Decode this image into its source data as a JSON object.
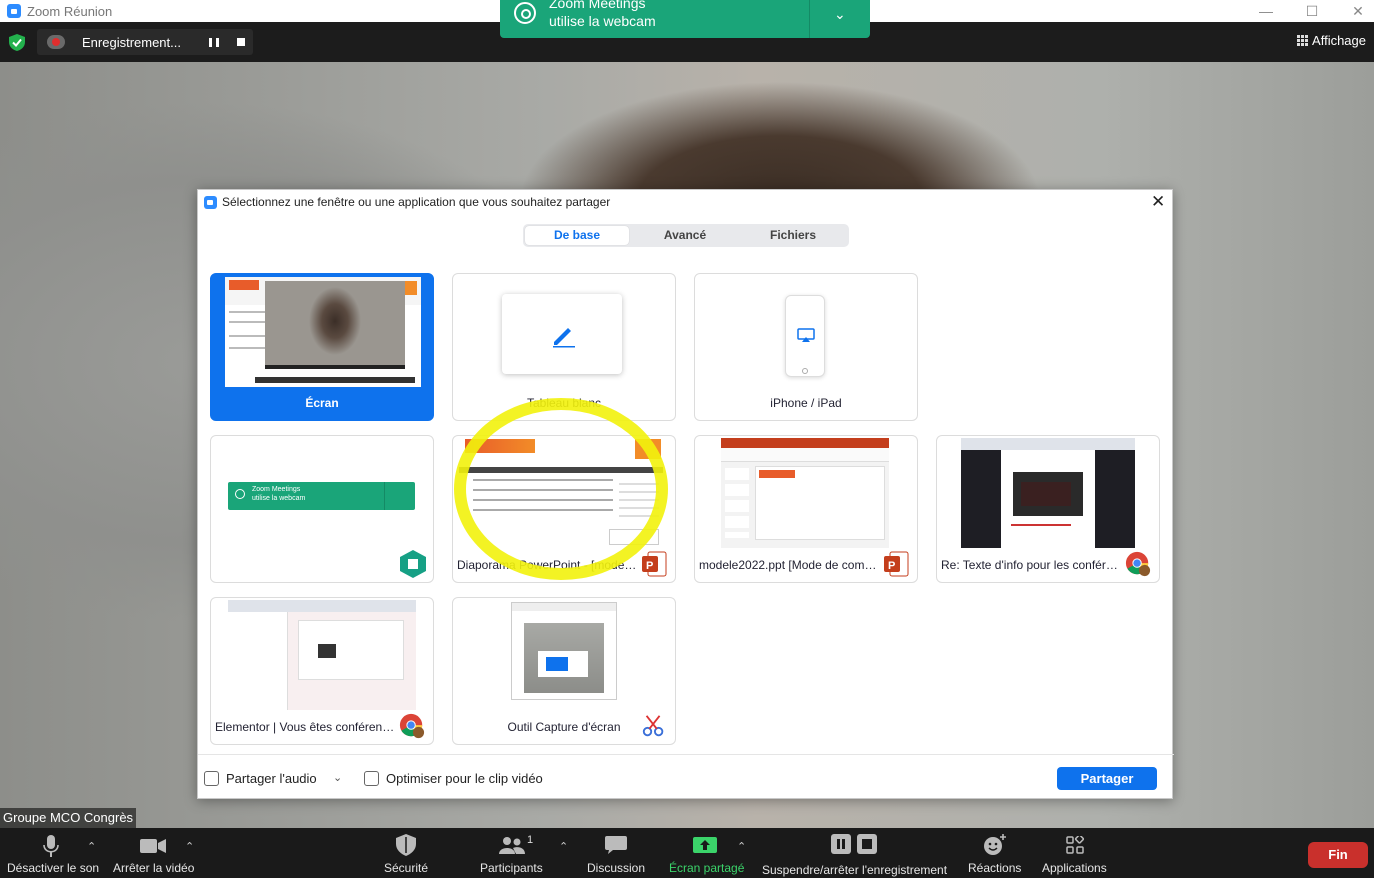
{
  "window": {
    "title": "Zoom Réunion",
    "controls": [
      "—",
      "☐",
      "✕"
    ]
  },
  "topbar": {
    "recording_label": "Enregistrement...",
    "view_label": "Affichage"
  },
  "notification": {
    "line1": "Zoom Meetings",
    "line2": "utilise la webcam"
  },
  "name_tag": "Groupe MCO Congrès",
  "dialog": {
    "title": "Sélectionnez une fenêtre ou une application que vous souhaitez partager",
    "tabs": [
      {
        "label": "De base",
        "active": true
      },
      {
        "label": "Avancé",
        "active": false
      },
      {
        "label": "Fichiers",
        "active": false
      }
    ],
    "items": [
      {
        "label": "Écran",
        "selected": true
      },
      {
        "label": "Tableau blanc"
      },
      {
        "label": "iPhone / iPad"
      },
      {
        "label": "",
        "thumb_line1": "Zoom Meetings",
        "thumb_line2": "utilise la webcam"
      },
      {
        "label": "Diaporama PowerPoint - [model..."
      },
      {
        "label": "modele2022.ppt [Mode de comp..."
      },
      {
        "label": "Re: Texte d'info pour les conféren..."
      },
      {
        "label": "Elementor | Vous êtes conférenci..."
      },
      {
        "label": "Outil Capture d'écran"
      }
    ],
    "footer": {
      "share_audio": "Partager l'audio",
      "optimize_video": "Optimiser pour le clip vidéo",
      "share_button": "Partager"
    }
  },
  "toolbar": {
    "mute": "Désactiver le son",
    "video": "Arrêter la vidéo",
    "security": "Sécurité",
    "participants": "Participants",
    "participants_count": "1",
    "chat": "Discussion",
    "share": "Écran partagé",
    "record": "Suspendre/arrêter l'enregistrement",
    "reactions": "Réactions",
    "apps": "Applications",
    "end": "Fin"
  },
  "colors": {
    "zoom_blue": "#0e72ed",
    "notif_green": "#1aa579",
    "share_green": "#3bd46a",
    "end_red": "#c9302c",
    "highlight_yellow": "#f2f20c"
  }
}
